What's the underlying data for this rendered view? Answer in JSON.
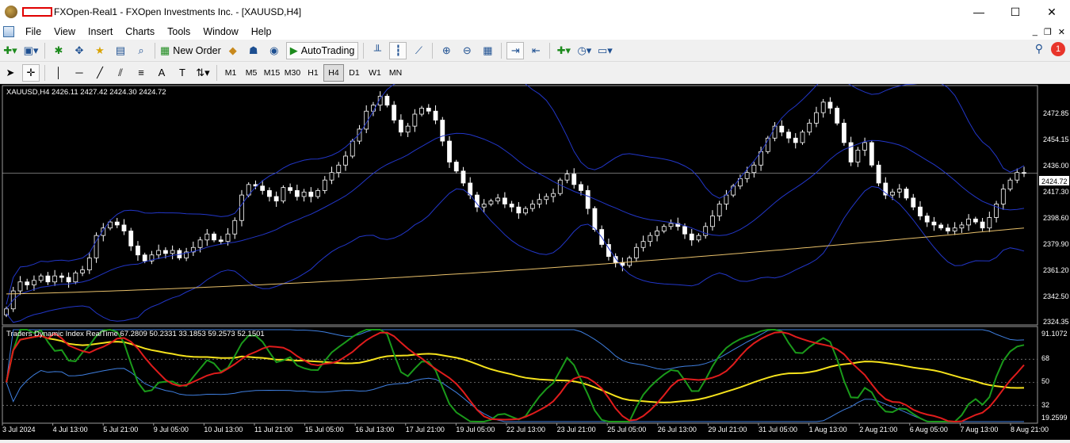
{
  "window": {
    "title": "FXOpen-Real1 - FXOpen Investments Inc. - [XAUUSD,H4]",
    "minimize": "—",
    "maximize": "☐",
    "close": "✕"
  },
  "menu": [
    "File",
    "View",
    "Insert",
    "Charts",
    "Tools",
    "Window",
    "Help"
  ],
  "toolbar": {
    "new_order": "New Order",
    "autotrading": "AutoTrading",
    "notification_count": "1"
  },
  "timeframes": [
    "M1",
    "M5",
    "M15",
    "M30",
    "H1",
    "H4",
    "D1",
    "W1",
    "MN"
  ],
  "active_timeframe": "H4",
  "chart": {
    "header": "XAUUSD,H4  2426.11 2427.42 2424.30 2424.72",
    "price_labels": [
      "2472.85",
      "2454.15",
      "2436.00",
      "2417.30",
      "2398.60",
      "2379.90",
      "2361.20",
      "2342.50",
      "2324.35"
    ],
    "current_price": "2424.72",
    "indicator_header": "Traders Dynamic Index RealTime 67.2809 50.2331 33.1853 59.2573 52.1501",
    "indicator_labels": [
      "91.1072",
      "68",
      "50",
      "32",
      "19.2599"
    ],
    "time_labels": [
      "3 Jul 2024",
      "4 Jul 13:00",
      "5 Jul 21:00",
      "9 Jul 05:00",
      "10 Jul 13:00",
      "11 Jul 21:00",
      "15 Jul 05:00",
      "16 Jul 13:00",
      "17 Jul 21:00",
      "19 Jul 05:00",
      "22 Jul 13:00",
      "23 Jul 21:00",
      "25 Jul 05:00",
      "26 Jul 13:00",
      "29 Jul 21:00",
      "31 Jul 05:00",
      "1 Aug 13:00",
      "2 Aug 21:00",
      "6 Aug 05:00",
      "7 Aug 13:00",
      "8 Aug 21:00"
    ]
  },
  "chart_data": {
    "type": "candlestick",
    "symbol": "XAUUSD",
    "timeframe": "H4",
    "ylim": [
      2324.35,
      2482
    ],
    "closes": [
      2334,
      2346,
      2352,
      2350,
      2353,
      2356,
      2352,
      2356,
      2355,
      2352,
      2358,
      2360,
      2368,
      2383,
      2388,
      2392,
      2390,
      2386,
      2376,
      2370,
      2366,
      2370,
      2373,
      2371,
      2373,
      2368,
      2372,
      2375,
      2380,
      2384,
      2380,
      2379,
      2384,
      2393,
      2410,
      2417,
      2416,
      2413,
      2409,
      2406,
      2415,
      2413,
      2409,
      2412,
      2409,
      2413,
      2420,
      2425,
      2430,
      2436,
      2446,
      2454,
      2466,
      2470,
      2476,
      2470,
      2460,
      2452,
      2456,
      2464,
      2468,
      2466,
      2460,
      2446,
      2432,
      2426,
      2418,
      2410,
      2402,
      2404,
      2406,
      2408,
      2404,
      2402,
      2398,
      2401,
      2404,
      2407,
      2409,
      2411,
      2420,
      2424,
      2417,
      2413,
      2401,
      2387,
      2377,
      2369,
      2365,
      2363,
      2368,
      2375,
      2379,
      2383,
      2386,
      2389,
      2391,
      2389,
      2384,
      2380,
      2383,
      2389,
      2396,
      2404,
      2410,
      2416,
      2421,
      2425,
      2430,
      2439,
      2448,
      2456,
      2452,
      2448,
      2445,
      2452,
      2458,
      2465,
      2472,
      2468,
      2458,
      2445,
      2432,
      2440,
      2445,
      2430,
      2418,
      2410,
      2412,
      2414,
      2408,
      2402,
      2396,
      2392,
      2390,
      2388,
      2386,
      2388,
      2390,
      2394,
      2392,
      2388,
      2395,
      2404,
      2414,
      2420,
      2425,
      2424.72
    ]
  }
}
